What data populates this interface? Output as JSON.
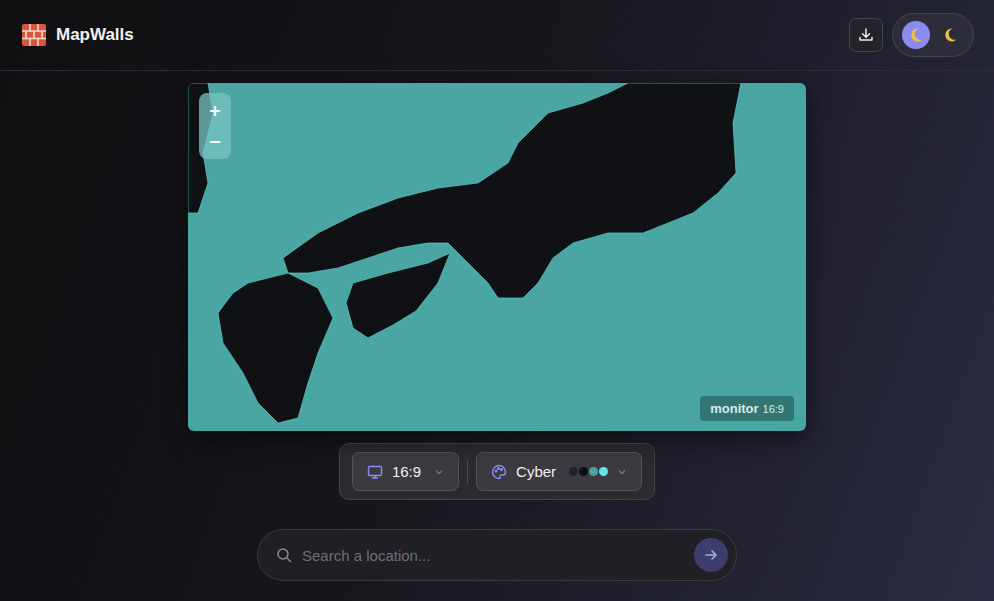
{
  "app": {
    "title": "MapWalls"
  },
  "header": {
    "theme_toggle": [
      {
        "name": "dark",
        "selected": true
      },
      {
        "name": "night",
        "selected": false
      }
    ]
  },
  "map": {
    "zoom": {
      "in": "+",
      "out": "−"
    },
    "badge": {
      "device": "monitor",
      "ratio": "16:9"
    }
  },
  "controls": {
    "aspect": {
      "label": "16:9"
    },
    "palette": {
      "label": "Cyber",
      "swatches": [
        {
          "color": "#1e2130"
        },
        {
          "color": "#0f1014"
        },
        {
          "color": "#4aa6a2"
        },
        {
          "color": "#5ee8e8"
        }
      ]
    }
  },
  "search": {
    "placeholder": "Search a location..."
  }
}
